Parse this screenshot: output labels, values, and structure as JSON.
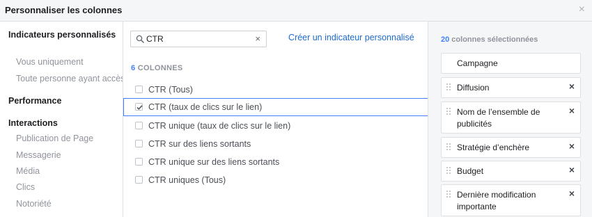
{
  "dialog": {
    "title": "Personnaliser les colonnes",
    "close_label": "×"
  },
  "sidebar": {
    "sections": [
      {
        "heading": "Indicateurs personnalisés",
        "items": [
          "Vous uniquement",
          "Toute personne ayant accès"
        ]
      },
      {
        "heading": "Performance",
        "items": []
      },
      {
        "heading": "Interactions",
        "items": [
          "Publication de Page",
          "Messagerie",
          "Média",
          "Clics",
          "Notoriété"
        ]
      }
    ]
  },
  "search": {
    "value": "CTR",
    "placeholder": "",
    "clear_label": "×"
  },
  "create_link": "Créer un indicateur personnalisé",
  "results": {
    "count": "6",
    "count_suffix": " COLONNES",
    "options": [
      {
        "label": "CTR (Tous)",
        "checked": false
      },
      {
        "label": "CTR (taux de clics sur le lien)",
        "checked": true
      },
      {
        "label": "CTR unique (taux de clics sur le lien)",
        "checked": false
      },
      {
        "label": "CTR sur des liens sortants",
        "checked": false
      },
      {
        "label": "CTR unique sur des liens sortants",
        "checked": false
      },
      {
        "label": "CTR uniques (Tous)",
        "checked": false
      }
    ]
  },
  "selected": {
    "count": "20",
    "count_suffix": " colonnes sélectionnées",
    "columns": [
      {
        "label": "Campagne",
        "removable": false
      },
      {
        "label": "Diffusion",
        "removable": true
      },
      {
        "label": "Nom de l’ensemble de publicités",
        "removable": true
      },
      {
        "label": "Stratégie d’enchère",
        "removable": true
      },
      {
        "label": "Budget",
        "removable": true
      },
      {
        "label": "Dernière modification importante",
        "removable": true
      }
    ],
    "remove_label": "×"
  },
  "colors": {
    "accent": "#4080ff",
    "link": "#1f6acb",
    "muted": "#90949c"
  }
}
